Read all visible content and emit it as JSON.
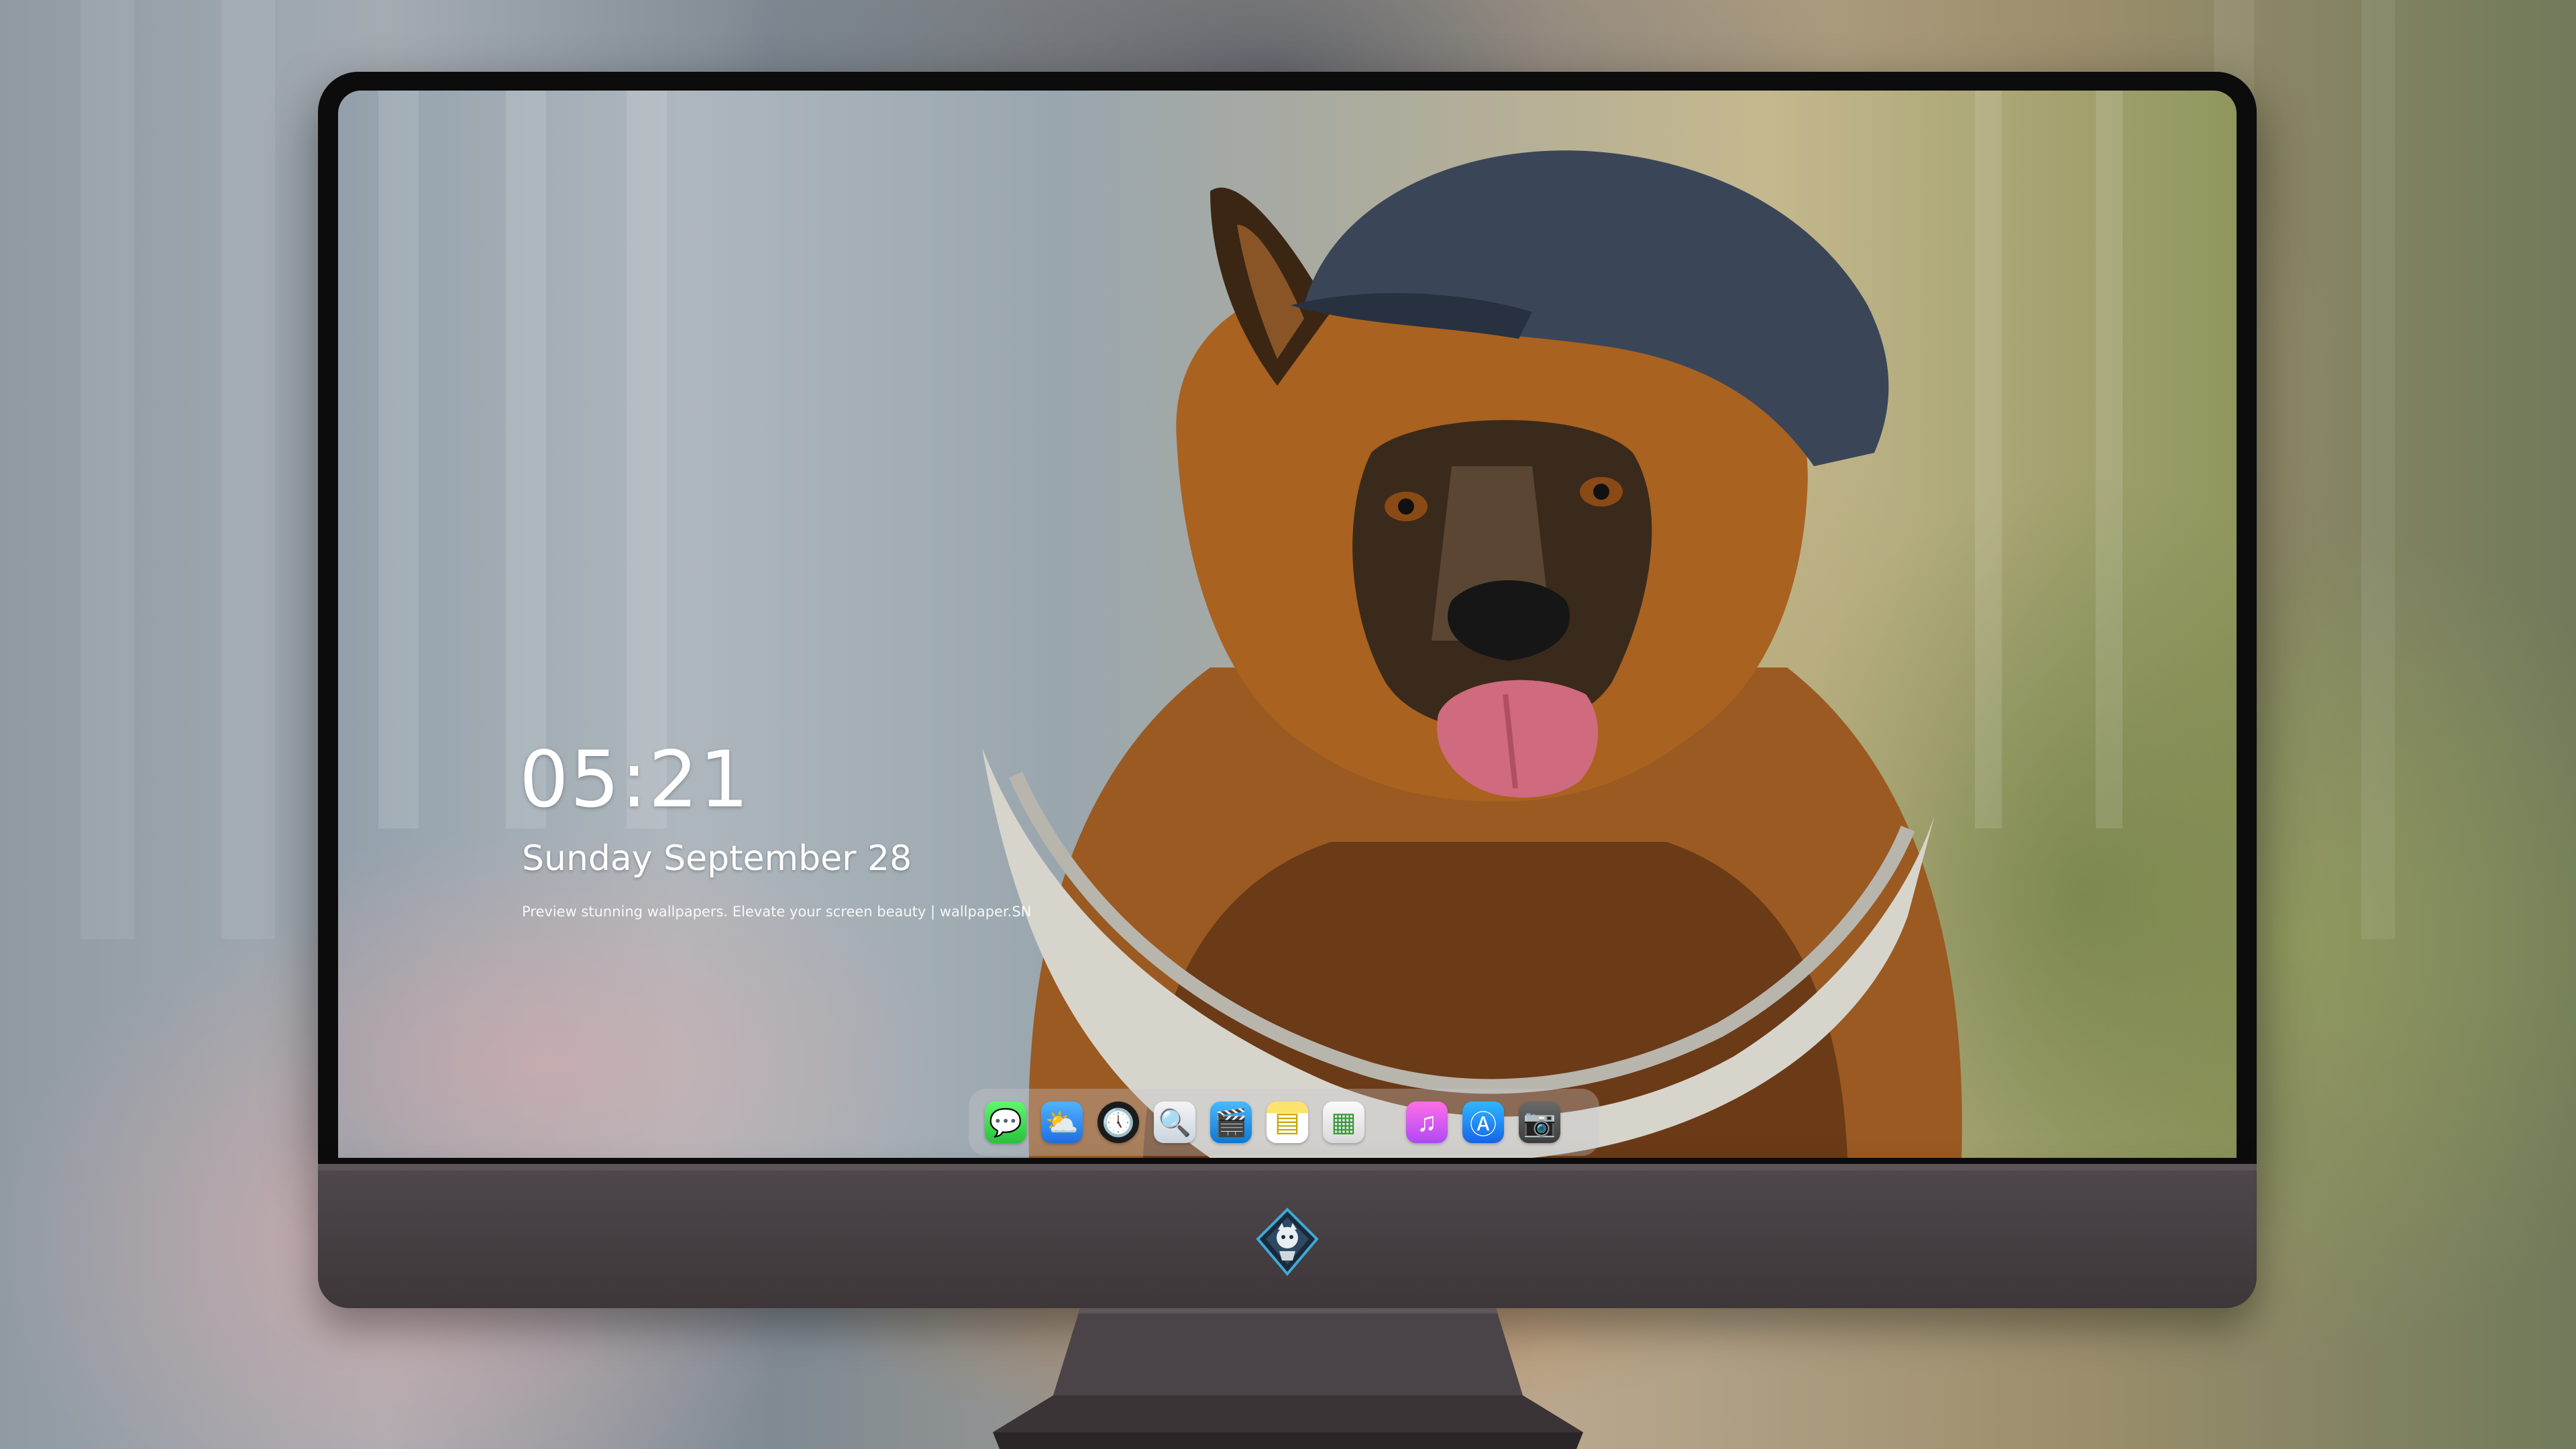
{
  "lockscreen": {
    "time": "05:21",
    "date": "Sunday September  28",
    "tagline": "Preview stunning wallpapers. Elevate your screen beauty | wallpaper.SN"
  },
  "dock": {
    "apps": [
      {
        "name": "Messages",
        "icon": "message-bubble-icon",
        "glyph": "💬"
      },
      {
        "name": "Weather",
        "icon": "cloud-sun-icon",
        "glyph": "⛅"
      },
      {
        "name": "Clock",
        "icon": "clock-icon",
        "glyph": "🕔"
      },
      {
        "name": "Preview",
        "icon": "magnifier-photo-icon",
        "glyph": "🔍"
      },
      {
        "name": "Clips",
        "icon": "clapperboard-icon",
        "glyph": "🎬"
      },
      {
        "name": "Notes",
        "icon": "notepad-icon",
        "glyph": "▤"
      },
      {
        "name": "Photo Booth",
        "icon": "photo-grid-icon",
        "glyph": "▦"
      },
      {
        "name": "Music",
        "icon": "music-note-icon",
        "glyph": "♫"
      },
      {
        "name": "App Store",
        "icon": "app-store-icon",
        "glyph": "Ⓐ"
      },
      {
        "name": "Camera",
        "icon": "camera-icon",
        "glyph": "📷"
      }
    ]
  },
  "monitor": {
    "logo": "mascot-emblem-icon"
  },
  "colors": {
    "screen_text": "#ffffff",
    "chin": "#4e474b",
    "bezel": "#0c0c0d"
  }
}
